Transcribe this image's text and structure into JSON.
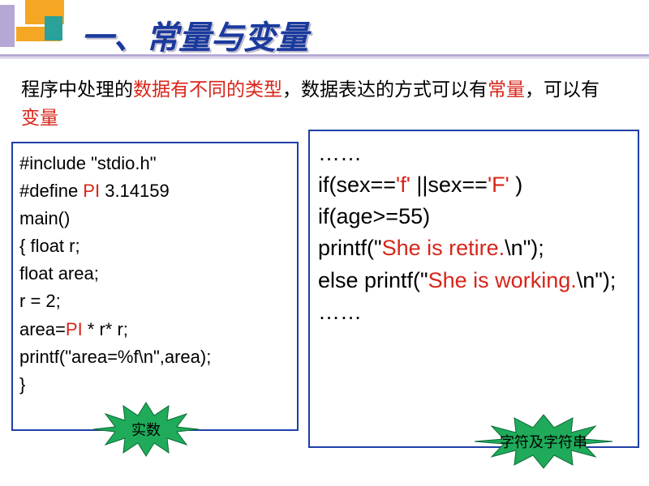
{
  "title": "一、常量与变量",
  "intro": {
    "p1a": "程序中处理的",
    "p1b": "数据有不同的类型",
    "p1c": "，数据表达的方式可以有",
    "p1d": "常量",
    "p1e": "，可以有",
    "p1f": "变量"
  },
  "left": {
    "l1": "#include \"stdio.h\"",
    "l2a": "#define   ",
    "l2b": "PI",
    "l2c": "   3.14159",
    "l3": "main()",
    "l4": "{  float r;",
    "l5": "    float   area;",
    "l6": "    r = 2;",
    "l7a": "   area=",
    "l7b": "PI",
    "l7c": " * r* r;",
    "l8": "   printf(\"area=%f\\n\",area);",
    "l9": "}"
  },
  "right": {
    "r1": "……",
    "r2a": "if(sex==",
    "r2b": "'f'",
    "r2c": " ||sex==",
    "r2d": "'F'",
    "r2e": " )",
    "r3": "   if(age>=55)",
    "r4a": "   printf(\"",
    "r4b": "She is retire.",
    "r4c": "\\n\");",
    "r5a": "    else printf(\"",
    "r5b": "She is working.",
    "r5c": "\\n\");",
    "r6": "……"
  },
  "labels": {
    "real": "实数",
    "charstr": "字符及字符串"
  }
}
